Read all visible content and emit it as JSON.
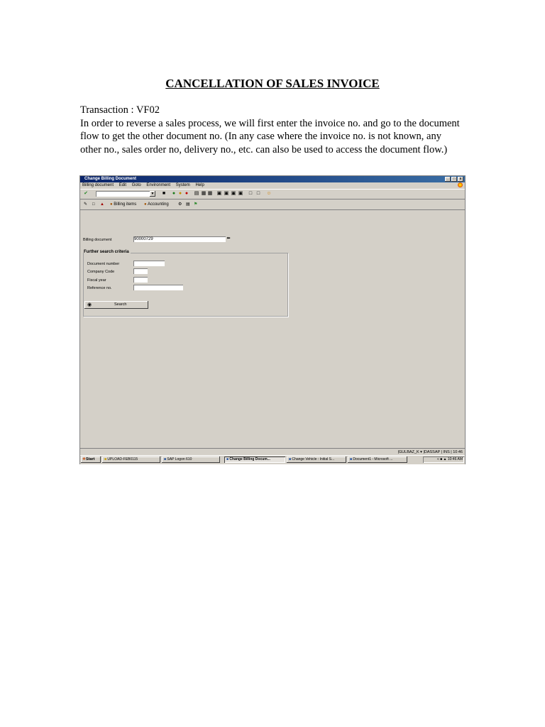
{
  "doc": {
    "title": "CANCELLATION OF SALES INVOICE",
    "transaction_line": "Transaction : VF02",
    "paragraph": "In order to reverse a sales process, we will first enter the invoice no. and go to the document flow to get the other document no. (In any case where the invoice no. is not known, any other no., sales order no, delivery no., etc. can also be used to access the document flow.)"
  },
  "sap": {
    "window_title": "Change Billing Document",
    "window_buttons": [
      "_",
      "□",
      "x"
    ],
    "menu": [
      "Billing document",
      "Edit",
      "Goto",
      "Environment",
      "System",
      "Help"
    ],
    "toolbar2": {
      "billing_items": "Billing items",
      "accounting": "Accounting"
    },
    "billing_document": {
      "label": "Billing document",
      "value": "90000729"
    },
    "search_group": {
      "title": "Further search criteria",
      "fields": [
        {
          "label": "Document number",
          "value": ""
        },
        {
          "label": "Company Code",
          "value": ""
        },
        {
          "label": "Fiscal year",
          "value": ""
        },
        {
          "label": "Reference no.",
          "value": ""
        }
      ],
      "search_button": "Search"
    },
    "status_bar": "|GULBAZ_K ▾ |DASSAP | INS | 10:46",
    "taskbar": {
      "start": "Start",
      "tasks": [
        "UPLOAD-FEB0115",
        "SAP Logon 610",
        "Change Billing Docum...",
        "Change Vehicle : Initial S...",
        "Document1 - Microsoft ..."
      ],
      "clock": "10:46 AM"
    }
  }
}
